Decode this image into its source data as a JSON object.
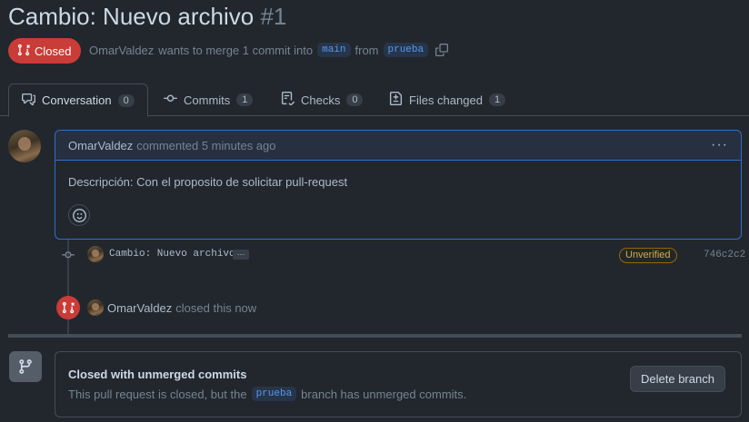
{
  "pr": {
    "title": "Cambio: Nuevo archivo",
    "number": "#1",
    "state": "Closed",
    "author": "OmarValdez",
    "merge_text_a": "wants to merge 1 commit into",
    "base_branch": "main",
    "merge_text_b": "from",
    "head_branch": "prueba"
  },
  "tabs": [
    {
      "label": "Conversation",
      "count": "0",
      "icon": "comment-discussion-icon"
    },
    {
      "label": "Commits",
      "count": "1",
      "icon": "git-commit-icon"
    },
    {
      "label": "Checks",
      "count": "0",
      "icon": "checklist-icon"
    },
    {
      "label": "Files changed",
      "count": "1",
      "icon": "file-diff-icon"
    }
  ],
  "comment": {
    "author": "OmarValdez",
    "action": "commented 5 minutes ago",
    "body": "Descripción: Con el proposito de solicitar pull-request",
    "menu": "···"
  },
  "commit": {
    "message": "Cambio: Nuevo archivo",
    "expand": "…",
    "badge": "Unverified",
    "sha": "746c2c2"
  },
  "closed_event": {
    "author": "OmarValdez",
    "text": "closed this now"
  },
  "merge_box": {
    "title": "Closed with unmerged commits",
    "desc_a": "This pull request is closed, but the",
    "branch": "prueba",
    "desc_b": "branch has unmerged commits.",
    "button": "Delete branch"
  },
  "colors": {
    "background": "#22272e",
    "closed_red": "#c93c37",
    "accent_blue": "#316dca",
    "warning": "#daaa3f"
  }
}
